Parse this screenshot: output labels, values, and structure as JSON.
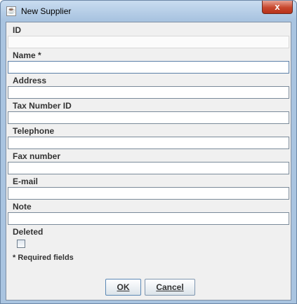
{
  "window": {
    "title": "New Supplier",
    "close_glyph": "x"
  },
  "form": {
    "fields": [
      {
        "label": "ID",
        "value": ""
      },
      {
        "label": "Name *",
        "value": ""
      },
      {
        "label": "Address",
        "value": ""
      },
      {
        "label": "Tax Number ID",
        "value": ""
      },
      {
        "label": "Telephone",
        "value": ""
      },
      {
        "label": "Fax number",
        "value": ""
      },
      {
        "label": "E-mail",
        "value": ""
      },
      {
        "label": "Note",
        "value": ""
      }
    ],
    "deleted_label": "Deleted",
    "deleted_checked": false,
    "required_note": "* Required fields"
  },
  "buttons": {
    "ok_label": "OK",
    "cancel_label": "Cancel"
  },
  "icons": {
    "app": "java-cup-icon",
    "close": "close-icon"
  }
}
